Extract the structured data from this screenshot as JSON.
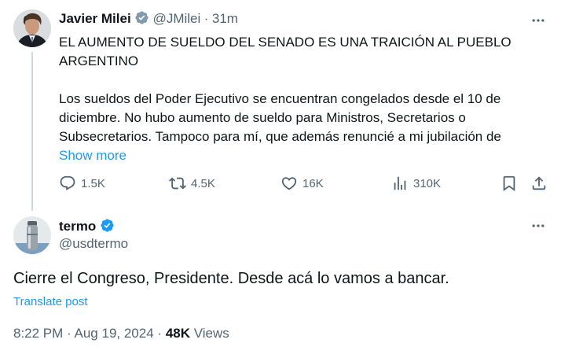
{
  "parent": {
    "name": "Javier Milei",
    "handle": "@JMilei",
    "separator": "·",
    "time": "31m",
    "headline": "EL AUMENTO DE SUELDO DEL SENADO ES UNA TRAICIÓN AL PUEBLO ARGENTINO",
    "body": "Los sueldos del Poder Ejecutivo se encuentran congelados desde el 10 de diciembre. No hubo aumento de sueldo para Ministros, Secretarios o Subsecretarios. Tampoco para mí, que además renuncié a mi jubilación de",
    "show_more": "Show more",
    "actions": {
      "replies": "1.5K",
      "reposts": "4.5K",
      "likes": "16K",
      "views": "310K"
    },
    "verified_color": "#829aab"
  },
  "reply": {
    "name": "termo",
    "handle": "@usdtermo",
    "text": "Cierre el Congreso, Presidente. Desde acá lo vamos a bancar.",
    "translate": "Translate post",
    "time": "8:22 PM",
    "date": "Aug 19, 2024",
    "separator": "·",
    "views_count": "48K",
    "views_label": "Views",
    "verified_color": "#1d9bf0"
  },
  "icons": [
    "more-icon",
    "reply-icon",
    "repost-icon",
    "like-icon",
    "views-icon",
    "bookmark-icon",
    "share-icon",
    "verified-icon"
  ],
  "colors": {
    "link": "#1d9bf0",
    "secondary": "#536471",
    "text": "#0f1419"
  }
}
